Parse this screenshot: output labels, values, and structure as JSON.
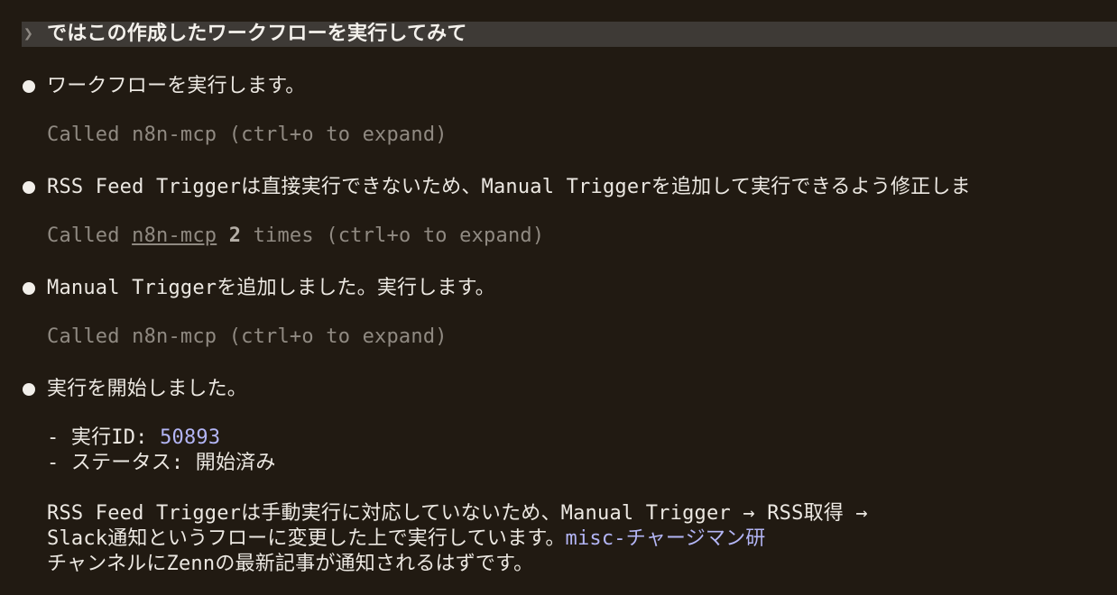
{
  "prompt": {
    "caret": "❯",
    "text": "ではこの作成したワークフローを実行してみて"
  },
  "messages": [
    {
      "text": "ワークフローを実行します。"
    },
    {
      "text": "RSS Feed Triggerは直接実行できないため、Manual Triggerを追加して実行できるよう修正しま"
    },
    {
      "text": "Manual Triggerを追加しました。実行します。"
    },
    {
      "text": "実行を開始しました。"
    }
  ],
  "tool_calls": [
    {
      "prefix": "Called ",
      "tool": "n8n-mcp",
      "suffix": " (ctrl+o to expand)"
    },
    {
      "prefix": "Called ",
      "tool": "n8n-mcp",
      "count": "2",
      "times": " times",
      "suffix": " (ctrl+o to expand)"
    },
    {
      "prefix": "Called ",
      "tool": "n8n-mcp",
      "suffix": " (ctrl+o to expand)"
    }
  ],
  "result": {
    "exec_id_label": "- 実行ID: ",
    "exec_id_value": "50893",
    "status_label": "- ステータス: ",
    "status_value": "開始済み",
    "note_line1": "RSS Feed Triggerは手動実行に対応していないため、Manual Trigger → RSS取得 →",
    "note_line2_a": "Slack通知というフローに変更した上で実行しています。",
    "note_line2_channel": "misc-チャージマン研",
    "note_line3": "チャンネルにZennの最新記事が通知されるはずです。"
  },
  "colors": {
    "background": "#211a12",
    "prompt_bar": "#3e3a36",
    "text": "#ece8e2",
    "muted": "#908a82",
    "accent": "#b3b5f5"
  }
}
